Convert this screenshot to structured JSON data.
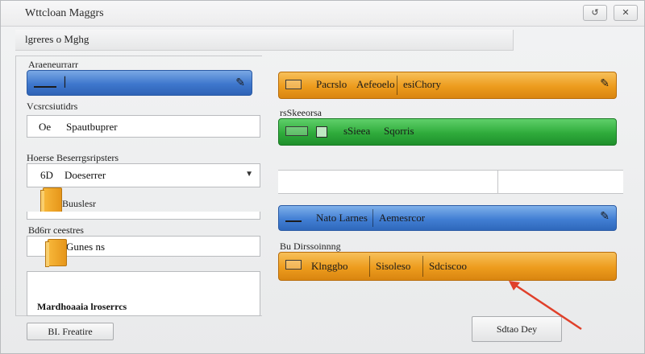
{
  "window": {
    "title": "Wttcloan Maggrs",
    "controls": [
      "↺",
      "✕"
    ]
  },
  "menu": {
    "label": "lgreres o Mghg"
  },
  "left": {
    "section1_label": "Araeneurrarr",
    "section2_label": "Vcsrcsiutidrs",
    "field1_prefix": "Oe",
    "field1_value": "Spautbuprer",
    "section3_label": "Hoerse Beserrgsripsters",
    "dropdown_prefix": "6D",
    "dropdown_value": "Doeserrer",
    "folder1_label": "Buuslesr",
    "section4_label": "Bd6rr ceestres",
    "field2_value": "Gunes ns",
    "footer_label": "Mardhoaaia lroserrcs",
    "bottom_button": "BI. Freatire"
  },
  "right": {
    "bar1_segments": [
      "Pacrslo",
      "Aefeoelo",
      "esiChory"
    ],
    "section2_label": "rsSkeeorsa",
    "bar2_segments": [
      "sSieea",
      "Sqorris"
    ],
    "bar3_segments": [
      "Nato Larnes",
      "Aemesrcor"
    ],
    "section4_label": "Bu Dirssoinnng",
    "bar4_segments": [
      "Klnggbo",
      "Sisoleso",
      "Sdciscoo"
    ],
    "bottom_button": "Sdtao Dey"
  },
  "colors": {
    "orange": "#ed9c1d",
    "green": "#2fab3b",
    "blue": "#427fd4",
    "arrow": "#e0402a"
  }
}
